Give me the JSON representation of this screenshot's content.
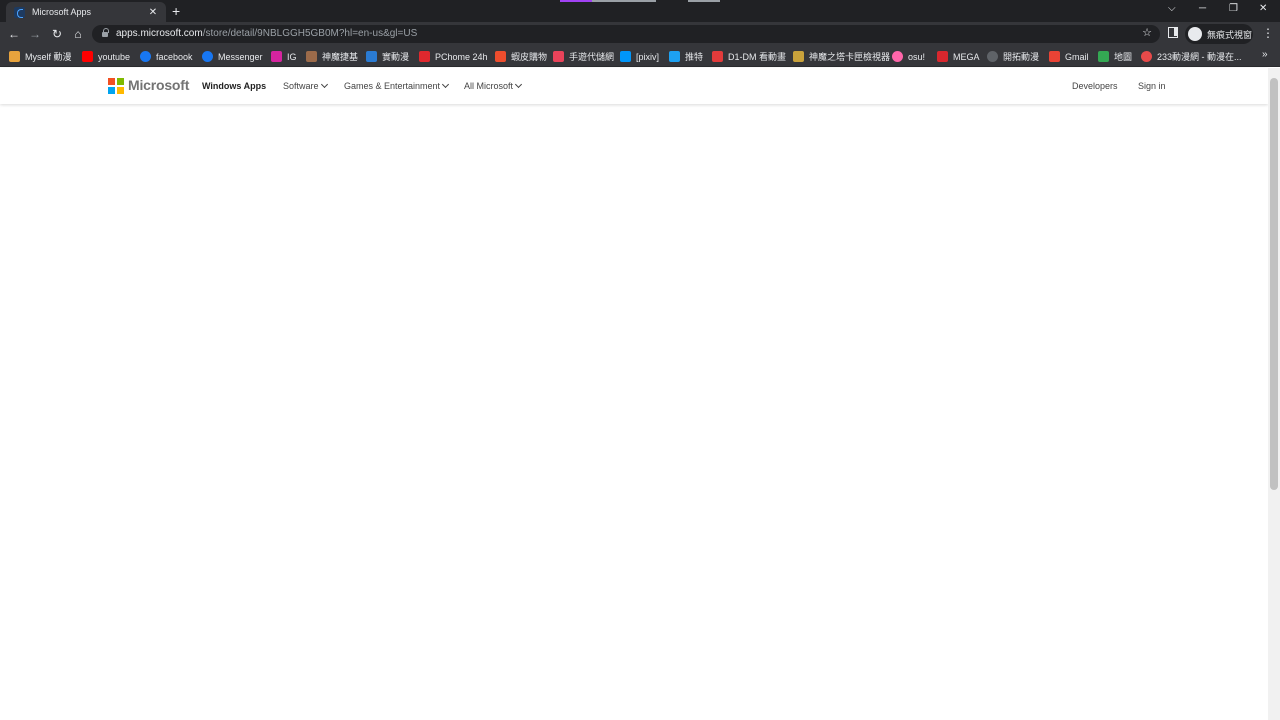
{
  "browser": {
    "tab_title": "Microsoft Apps",
    "close_tab_glyph": "✕",
    "new_tab_glyph": "+",
    "url_host": "apps.microsoft.com",
    "url_path": "/store/detail/9NBLGGH5GB0M?hl=en-us&gl=US",
    "incognito_label": "無痕式視窗",
    "window_controls": {
      "tab_search": "⌵",
      "minimize": "─",
      "restore": "❐",
      "close": "✕"
    },
    "nav": {
      "back": "←",
      "forward": "→",
      "reload": "↻",
      "home": "⌂",
      "star": "☆",
      "menu": "⋮"
    }
  },
  "bookmarks": {
    "more_glyph": "»",
    "items": [
      {
        "label": "Myself 動漫",
        "icon": "myself-icon",
        "color": "#e8a33d"
      },
      {
        "label": "youtube",
        "icon": "youtube-icon",
        "color": "#ff0000"
      },
      {
        "label": "facebook",
        "icon": "facebook-icon",
        "color": "#1877f2"
      },
      {
        "label": "Messenger",
        "icon": "facebook-icon",
        "color": "#1877f2"
      },
      {
        "label": "IG",
        "icon": "instagram-icon",
        "color": "#d6249f"
      },
      {
        "label": "神魔捷基",
        "icon": "wiki-icon",
        "color": "#9c6b4a"
      },
      {
        "label": "實動漫",
        "icon": "anime-icon",
        "color": "#2a7bd3"
      },
      {
        "label": "PChome 24h",
        "icon": "pchome-icon",
        "color": "#e0282e"
      },
      {
        "label": "蝦皮購物",
        "icon": "shopee-icon",
        "color": "#ee4d2d"
      },
      {
        "label": "手遊代儲網",
        "icon": "shop-icon",
        "color": "#e9435a"
      },
      {
        "label": "[pixiv]",
        "icon": "pixiv-icon",
        "color": "#0096fa"
      },
      {
        "label": "推特",
        "icon": "twitter-icon",
        "color": "#1da1f2"
      },
      {
        "label": "D1-DM 看動畫",
        "icon": "d1dm-icon",
        "color": "#e23b3b"
      },
      {
        "label": "神魔之塔卡匣檢視器",
        "icon": "card-icon",
        "color": "#c9a23b"
      },
      {
        "label": "osu!",
        "icon": "osu-icon",
        "color": "#ff66aa"
      },
      {
        "label": "MEGA",
        "icon": "mega-icon",
        "color": "#d9272e"
      },
      {
        "label": "開拓動漫",
        "icon": "globe-icon",
        "color": "#5f6368"
      },
      {
        "label": "Gmail",
        "icon": "gmail-icon",
        "color": "#ea4335"
      },
      {
        "label": "地圖",
        "icon": "maps-icon",
        "color": "#34a853"
      },
      {
        "label": "233動漫網 - 動漫在...",
        "icon": "anime233-icon",
        "color": "#e84a4a"
      }
    ]
  },
  "ms_header": {
    "brand": "Microsoft",
    "logo_colors": [
      "#f25022",
      "#7fba00",
      "#00a4ef",
      "#ffb900"
    ],
    "nav": {
      "windows_apps": "Windows Apps",
      "software": "Software",
      "games": "Games & Entertainment",
      "all_microsoft": "All Microsoft",
      "developers": "Developers",
      "sign_in": "Sign in"
    }
  }
}
